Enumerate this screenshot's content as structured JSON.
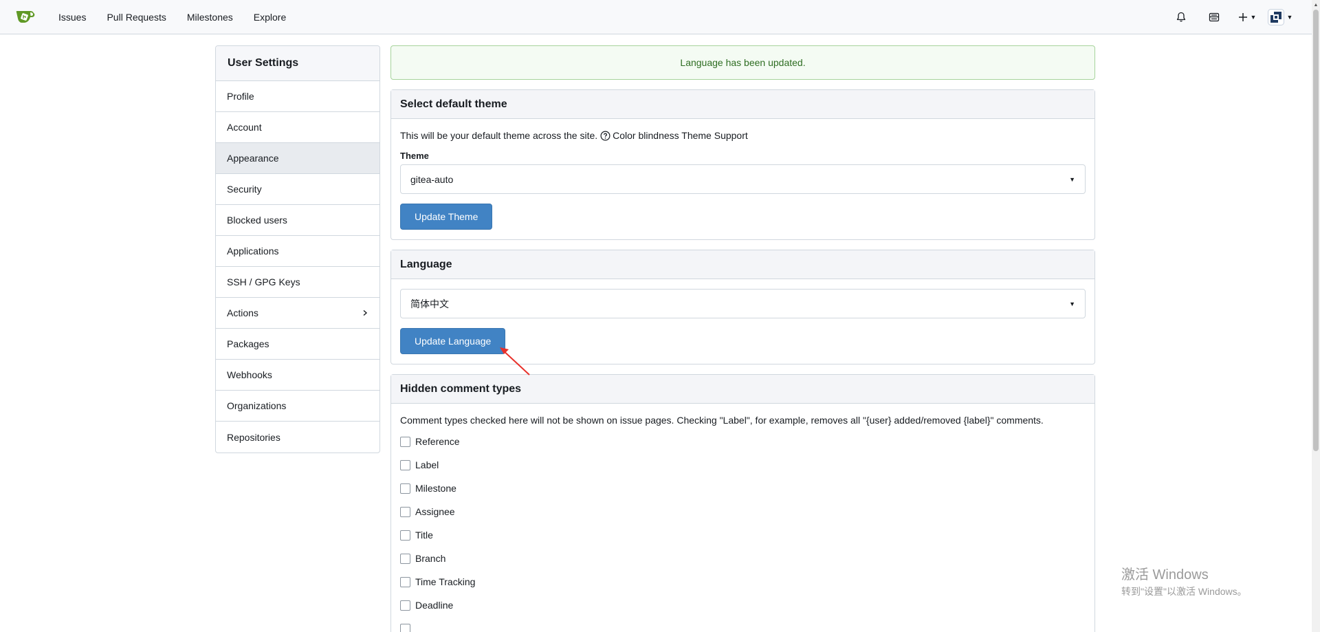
{
  "navbar": {
    "links": [
      "Issues",
      "Pull Requests",
      "Milestones",
      "Explore"
    ],
    "icons": [
      "bell-icon",
      "inbox-icon",
      "plus-icon",
      "avatar"
    ]
  },
  "sidebar": {
    "title": "User Settings",
    "items": [
      {
        "label": "Profile"
      },
      {
        "label": "Account"
      },
      {
        "label": "Appearance"
      },
      {
        "label": "Security"
      },
      {
        "label": "Blocked users"
      },
      {
        "label": "Applications"
      },
      {
        "label": "SSH / GPG Keys"
      },
      {
        "label": "Actions"
      },
      {
        "label": "Packages"
      },
      {
        "label": "Webhooks"
      },
      {
        "label": "Organizations"
      },
      {
        "label": "Repositories"
      }
    ],
    "active_index": 2
  },
  "flash": {
    "message": "Language has been updated."
  },
  "theme": {
    "header": "Select default theme",
    "help_text": "This will be your default theme across the site.",
    "help_link": "Color blindness Theme Support",
    "label": "Theme",
    "value": "gitea-auto",
    "button": "Update Theme"
  },
  "language": {
    "header": "Language",
    "value": "简体中文",
    "button": "Update Language"
  },
  "hidden_comments": {
    "header": "Hidden comment types",
    "description": "Comment types checked here will not be shown on issue pages. Checking \"Label\", for example, removes all \"{user} added/removed {label}\" comments.",
    "options": [
      "Reference",
      "Label",
      "Milestone",
      "Assignee",
      "Title",
      "Branch",
      "Time Tracking",
      "Deadline"
    ]
  },
  "watermark": {
    "title": "激活 Windows",
    "subtitle": "转到\"设置\"以激活 Windows。"
  },
  "colors": {
    "accent": "#4183c4",
    "success_border": "#a6d39b",
    "success_text": "#2e6d22",
    "annotation": "#e8302a"
  }
}
